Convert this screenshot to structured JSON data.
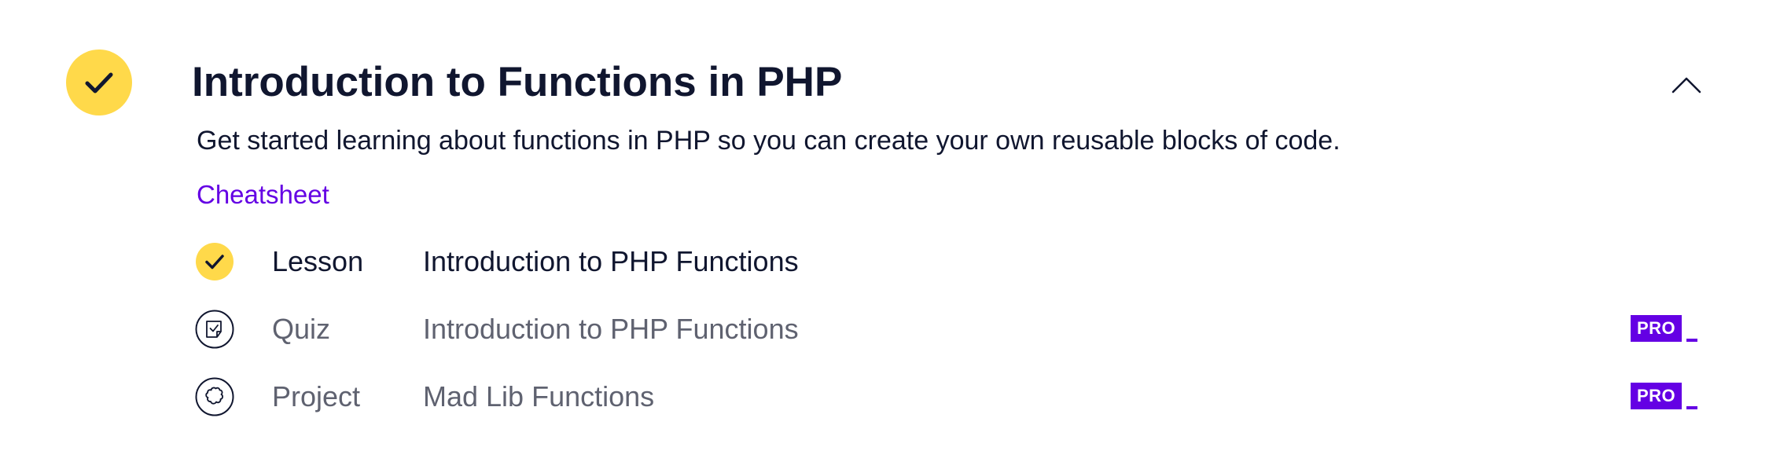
{
  "module": {
    "title": "Introduction to Functions in PHP",
    "description": "Get started learning about functions in PHP so you can create your own reusable blocks of code.",
    "cheatsheet_label": "Cheatsheet",
    "status": "completed",
    "status_icon": "check-icon",
    "collapse_icon": "chevron-up-icon"
  },
  "items": [
    {
      "type": "Lesson",
      "name": "Introduction to PHP Functions",
      "status": "completed",
      "icon": "check-icon",
      "pro": false
    },
    {
      "type": "Quiz",
      "name": "Introduction to PHP Functions",
      "status": "not-started",
      "icon": "quiz-icon",
      "pro": true,
      "pro_label": "PRO"
    },
    {
      "type": "Project",
      "name": "Mad Lib Functions",
      "status": "not-started",
      "icon": "puzzle-icon",
      "pro": true,
      "pro_label": "PRO"
    }
  ],
  "colors": {
    "accent": "#6400E4",
    "complete": "#FFD94A",
    "text_primary": "#10162F",
    "text_muted": "#5F6270"
  }
}
